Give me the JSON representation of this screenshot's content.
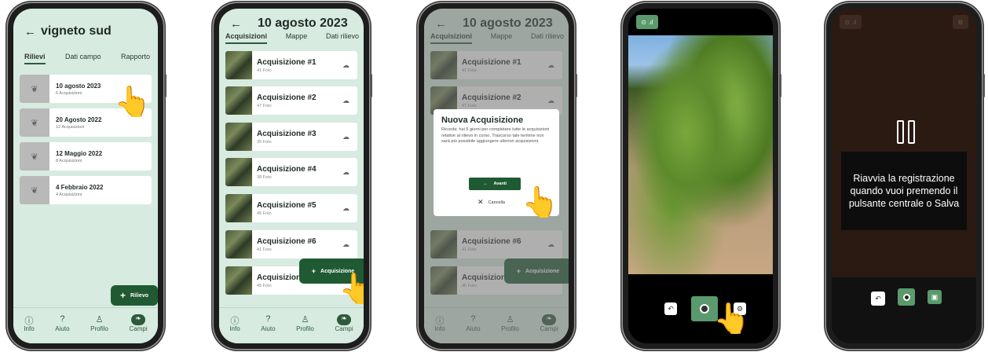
{
  "screen1": {
    "title": "vigneto sud",
    "tabs": [
      "Rilievi",
      "Dati campo",
      "Rapporto"
    ],
    "items": [
      {
        "title": "10 agosto 2023",
        "sub": "6 Acquisizioni"
      },
      {
        "title": "20 Agosto 2022",
        "sub": "12 Acquisizioni"
      },
      {
        "title": "12 Maggio 2022",
        "sub": "8 Acquisizioni"
      },
      {
        "title": "4 Febbraio 2022",
        "sub": "4 Acquisizioni"
      }
    ],
    "fab_label": "Rilievo"
  },
  "nav": {
    "info": "Info",
    "aiuto": "Aiuto",
    "profilo": "Profilo",
    "campi": "Campi"
  },
  "screen2": {
    "title": "10 agosto 2023",
    "tabs": [
      "Acquisizioni",
      "Mappe",
      "Dati rilievo"
    ],
    "items": [
      {
        "title": "Acquisizione #1",
        "sub": "41 Foto"
      },
      {
        "title": "Acquisizione #2",
        "sub": "47 Foto"
      },
      {
        "title": "Acquisizione #3",
        "sub": "35 Foto"
      },
      {
        "title": "Acquisizione #4",
        "sub": "38 Foto"
      },
      {
        "title": "Acquisizione #5",
        "sub": "45 Foto"
      },
      {
        "title": "Acquisizione #6",
        "sub": "41 Foto"
      },
      {
        "title": "Acquisizione #7",
        "sub": "45 Foto"
      }
    ],
    "fab_label": "Acquisizione"
  },
  "screen3": {
    "modal_title": "Nuova Acquisizione",
    "modal_text": "Ricorda: hai 5 giorni per completare tutte le acquisizioni relative al rilievo in corso. Trascorso tale termine non sarà più possibile aggiungere ulteriori acquisizioni.",
    "ok_label": "Avanti",
    "cancel_label": "Cancella"
  },
  "screen5": {
    "message": "Riavvia la registrazione quando vuoi premendo il pulsante centrale o Salva"
  }
}
